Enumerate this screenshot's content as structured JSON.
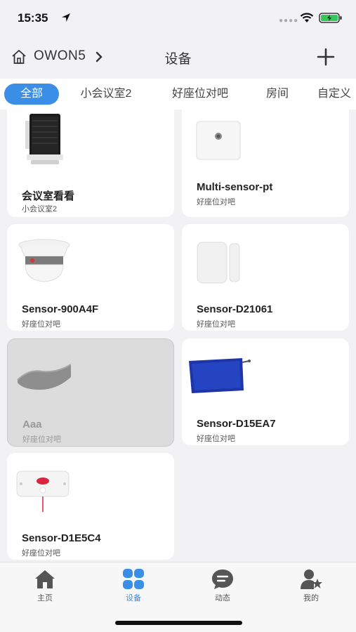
{
  "status_bar": {
    "time": "15:35",
    "location_icon": "location-arrow-icon",
    "signal_icon": "signal-dots-icon",
    "wifi_icon": "wifi-icon",
    "battery_icon": "battery-charging-icon"
  },
  "header": {
    "home_icon": "home-outline-icon",
    "home_name": "OWON5",
    "chevron_icon": "chevron-right-icon",
    "title": "设备",
    "add_icon": "plus-icon"
  },
  "tabs": [
    {
      "label": "全部",
      "active": true
    },
    {
      "label": "小会议室2",
      "active": false
    },
    {
      "label": "好座位对吧",
      "active": false
    },
    {
      "label": "房间",
      "active": false
    },
    {
      "label": "自定义",
      "active": false
    }
  ],
  "devices": [
    {
      "name": "会议室看看",
      "room": "小会议室2",
      "icon": "gateway-router-icon",
      "online": true
    },
    {
      "name": "Multi-sensor-pt",
      "room": "好座位对吧",
      "icon": "multi-sensor-icon",
      "online": true
    },
    {
      "name": "Sensor-900A4F",
      "room": "好座位对吧",
      "icon": "smoke-detector-icon",
      "online": true
    },
    {
      "name": "Sensor-D21061",
      "room": "好座位对吧",
      "icon": "door-window-sensor-icon",
      "online": true
    },
    {
      "name": "Aaa",
      "room": "好座位对吧",
      "icon": "curved-panel-icon",
      "online": false
    },
    {
      "name": "Sensor-D15EA7",
      "room": "好座位对吧",
      "icon": "bed-pad-sensor-icon",
      "online": true
    },
    {
      "name": "Sensor-D1E5C4",
      "room": "好座位对吧",
      "icon": "panic-button-icon",
      "online": true
    }
  ],
  "bottom_nav": [
    {
      "label": "主页",
      "icon": "home-filled-icon",
      "active": false
    },
    {
      "label": "设备",
      "icon": "devices-grid-icon",
      "active": true
    },
    {
      "label": "动态",
      "icon": "chat-bubble-icon",
      "active": false
    },
    {
      "label": "我的",
      "icon": "user-star-icon",
      "active": false
    }
  ],
  "colors": {
    "accent": "#3a8ee6",
    "background": "#f2f2f4",
    "card": "#ffffff",
    "offline_card": "#dcdcdc"
  }
}
